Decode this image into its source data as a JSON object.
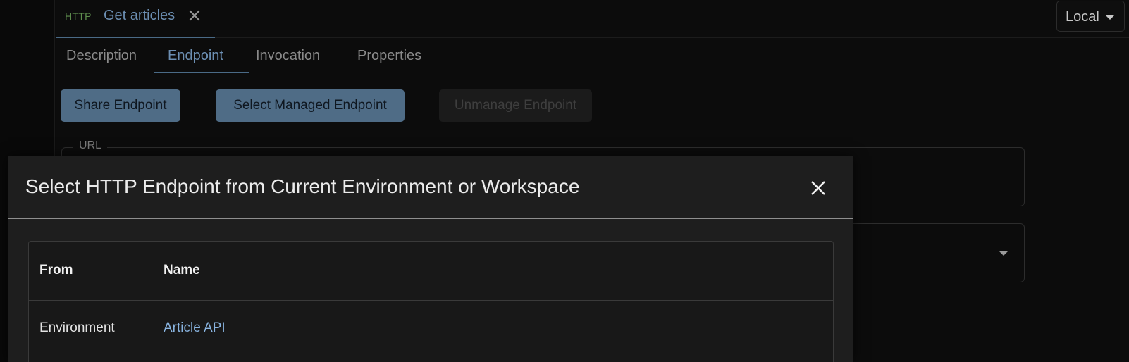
{
  "request_tab": {
    "method": "HTTP",
    "title": "Get articles"
  },
  "environment_select": {
    "value": "Local"
  },
  "section_tabs": [
    {
      "label": "Description"
    },
    {
      "label": "Endpoint",
      "active": true
    },
    {
      "label": "Invocation"
    },
    {
      "label": "Properties"
    }
  ],
  "actions": {
    "share_label": "Share Endpoint",
    "select_managed_label": "Select Managed Endpoint",
    "unmanage_label": "Unmanage Endpoint"
  },
  "url_field": {
    "label": "URL",
    "value": ""
  },
  "modal": {
    "title": "Select HTTP Endpoint from Current Environment or Workspace",
    "table": {
      "columns": [
        "From",
        "Name"
      ],
      "rows": [
        {
          "from": "Environment",
          "name": "Article API"
        }
      ]
    }
  },
  "colors": {
    "accent": "#6c8fb3",
    "method_http": "#5f8f4e",
    "link": "#89b4e0"
  },
  "icons": {
    "tab_close": "close-icon",
    "modal_close": "close-icon",
    "dropdown": "chevron-down-icon"
  }
}
